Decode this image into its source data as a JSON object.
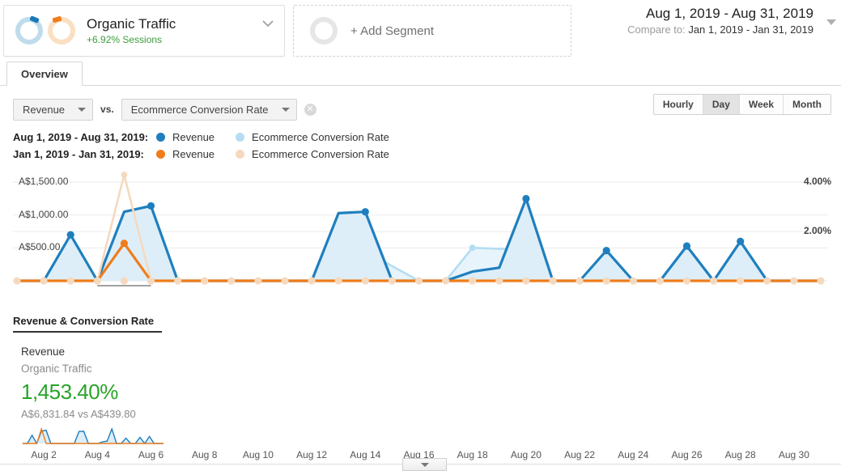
{
  "header": {
    "segment": {
      "title": "Organic Traffic",
      "subtitle": "+6.92% Sessions",
      "donut_blue_color": "#bfdcec",
      "donut_blue_tick_color": "#1a79b5",
      "donut_orange_color": "#fadfc2",
      "donut_orange_tick_color": "#ef7d1a",
      "chevron_icon": "chevron-down-icon"
    },
    "add_segment": {
      "label": "+ Add Segment",
      "ring_icon": "empty-circle-icon"
    },
    "date_range": {
      "primary": "Aug 1, 2019 - Aug 31, 2019",
      "compare_label": "Compare to:",
      "compare_value": "Jan 1, 2019 - Jan 31, 2019",
      "caret_icon": "caret-down-icon"
    }
  },
  "tabs": [
    {
      "label": "Overview",
      "active": true
    }
  ],
  "controls": {
    "metric_primary": "Revenue",
    "vs_label": "vs.",
    "metric_secondary": "Ecommerce Conversion Rate",
    "clear_icon": "clear-circle-icon",
    "clear_glyph": "✕",
    "granularity": [
      {
        "label": "Hourly",
        "active": false
      },
      {
        "label": "Day",
        "active": true
      },
      {
        "label": "Week",
        "active": false
      },
      {
        "label": "Month",
        "active": false
      }
    ]
  },
  "legend": [
    {
      "range": "Aug 1, 2019 - Aug 31, 2019:",
      "series": [
        {
          "name": "Revenue",
          "color": "#1f7fbe"
        },
        {
          "name": "Ecommerce Conversion Rate",
          "color": "#b4ddf2"
        }
      ]
    },
    {
      "range": "Jan 1, 2019 - Jan 31, 2019:",
      "series": [
        {
          "name": "Revenue",
          "color": "#ef7d1a"
        },
        {
          "name": "Ecommerce Conversion Rate",
          "color": "#f5d9bf"
        }
      ]
    }
  ],
  "chart_data": {
    "type": "line",
    "title": "",
    "xlabel": "",
    "ylabel": "Revenue",
    "y2label": "Ecommerce Conversion Rate",
    "grid": true,
    "legend_position": "above",
    "x": [
      "Aug 1",
      "Aug 2",
      "Aug 3",
      "Aug 4",
      "Aug 5",
      "Aug 6",
      "Aug 7",
      "Aug 8",
      "Aug 9",
      "Aug 10",
      "Aug 11",
      "Aug 12",
      "Aug 13",
      "Aug 14",
      "Aug 15",
      "Aug 16",
      "Aug 17",
      "Aug 18",
      "Aug 19",
      "Aug 20",
      "Aug 21",
      "Aug 22",
      "Aug 23",
      "Aug 24",
      "Aug 25",
      "Aug 26",
      "Aug 27",
      "Aug 28",
      "Aug 29",
      "Aug 30",
      "Aug 31"
    ],
    "y_left_ticks": [
      "A$500.00",
      "A$1,000.00",
      "A$1,500.00"
    ],
    "y_left_values": [
      500,
      1000,
      1500
    ],
    "ylim": [
      0,
      1650
    ],
    "y_right_ticks": [
      "2.00%",
      "4.00%"
    ],
    "y_right_values": [
      2.0,
      4.0
    ],
    "y2lim": [
      0,
      4.4
    ],
    "series": [
      {
        "name": "Revenue",
        "period": "Aug 1, 2019 - Aug 31, 2019",
        "axis": "left",
        "color": "#1f7fbe",
        "fill": "#ddeef9",
        "values": [
          0,
          0,
          700,
          0,
          1050,
          1140,
          0,
          0,
          0,
          0,
          0,
          0,
          1030,
          1050,
          0,
          0,
          0,
          140,
          200,
          1250,
          0,
          0,
          460,
          0,
          0,
          530,
          0,
          600,
          0,
          0,
          0
        ]
      },
      {
        "name": "Ecommerce Conversion Rate",
        "period": "Aug 1, 2019 - Aug 31, 2019",
        "axis": "right",
        "color": "#b4ddf2",
        "fill": "#e8f4fb",
        "values": [
          0,
          0,
          0.92,
          0,
          1.28,
          1.22,
          0,
          0,
          0,
          0,
          0,
          0,
          1.2,
          1.22,
          0.6,
          0,
          0,
          1.34,
          1.3,
          1.28,
          0,
          0,
          0.72,
          0,
          0,
          0.64,
          0,
          0.68,
          0,
          0,
          0
        ]
      },
      {
        "name": "Revenue",
        "period": "Jan 1, 2019 - Jan 31, 2019",
        "axis": "left",
        "color": "#ef7d1a",
        "fill": "none",
        "values": [
          0,
          0,
          0,
          0,
          570,
          0,
          0,
          0,
          0,
          0,
          0,
          0,
          0,
          0,
          0,
          0,
          0,
          0,
          0,
          0,
          0,
          0,
          0,
          0,
          0,
          0,
          0,
          0,
          0,
          0,
          0
        ]
      },
      {
        "name": "Ecommerce Conversion Rate",
        "period": "Jan 1, 2019 - Jan 31, 2019",
        "axis": "right",
        "color": "#f5d9bf",
        "fill": "none",
        "values": [
          0,
          0,
          0,
          0,
          4.3,
          0,
          0,
          0,
          0,
          0,
          0,
          0,
          0,
          0,
          0,
          0,
          0,
          0,
          0,
          0,
          0,
          0,
          0,
          0,
          0,
          0,
          0,
          0,
          0,
          0,
          0
        ]
      }
    ],
    "x_tick_labels": [
      "Aug 2",
      "Aug 4",
      "Aug 6",
      "Aug 8",
      "Aug 10",
      "Aug 12",
      "Aug 14",
      "Aug 16",
      "Aug 18",
      "Aug 20",
      "Aug 22",
      "Aug 24",
      "Aug 26",
      "Aug 28",
      "Aug 30"
    ]
  },
  "scrollbar": {
    "handle_icon": "chevron-down-icon"
  },
  "report": {
    "section_title": "Revenue & Conversion Rate",
    "metric_name": "Revenue",
    "segment_name": "Organic Traffic",
    "delta": "1,453.40%",
    "delta_color": "#29a329",
    "comparison": "A$6,831.84 vs A$439.80"
  }
}
